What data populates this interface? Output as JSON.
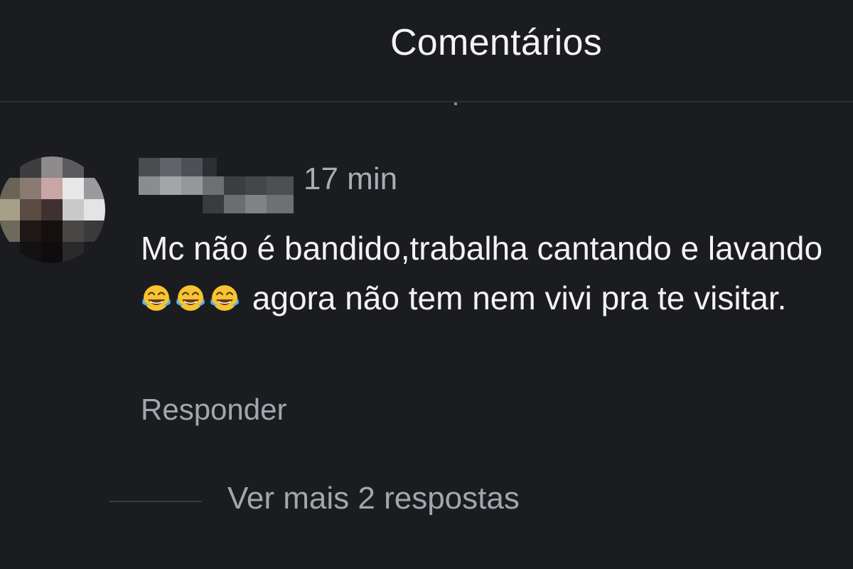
{
  "header": {
    "title": "Comentários"
  },
  "comment": {
    "timestamp": "17 min",
    "text_part1": "Mc não é bandido,trabalha cantando e lavando",
    "emojis": [
      "face-with-tears-of-joy-emoji",
      "face-with-tears-of-joy-emoji",
      "face-with-tears-of-joy-emoji"
    ],
    "text_part2": " agora não tem nem vivi pra te visitar.",
    "reply_label": "Responder"
  },
  "replies": {
    "label": "Ver mais 2 respostas"
  },
  "colors": {
    "background": "#1b1c20",
    "primary_text": "#f3f3f3",
    "secondary_text": "#a3a6ac",
    "divider": "#2c2d31"
  }
}
